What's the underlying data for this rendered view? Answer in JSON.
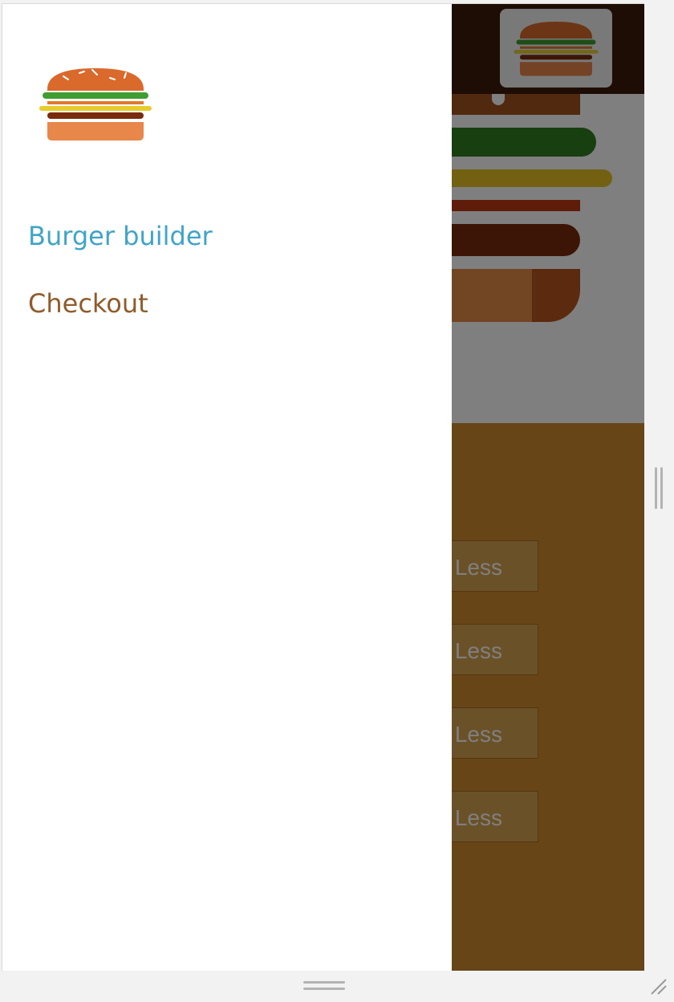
{
  "drawer": {
    "nav": [
      {
        "label": "Burger builder",
        "active": true
      },
      {
        "label": "Checkout",
        "active": false
      }
    ]
  },
  "controls": {
    "buttons": [
      {
        "label": "Less"
      },
      {
        "label": "Less"
      },
      {
        "label": "Less"
      },
      {
        "label": "Less"
      }
    ]
  },
  "colors": {
    "toolbar": "#3c1a08",
    "controls_bg": "#cf8a2e",
    "nav_active": "#40a4c8",
    "nav_inactive": "#8f5c2c"
  },
  "icons": {
    "logo": "burger-logo-icon",
    "toolbar_logo": "burger-logo-icon"
  }
}
